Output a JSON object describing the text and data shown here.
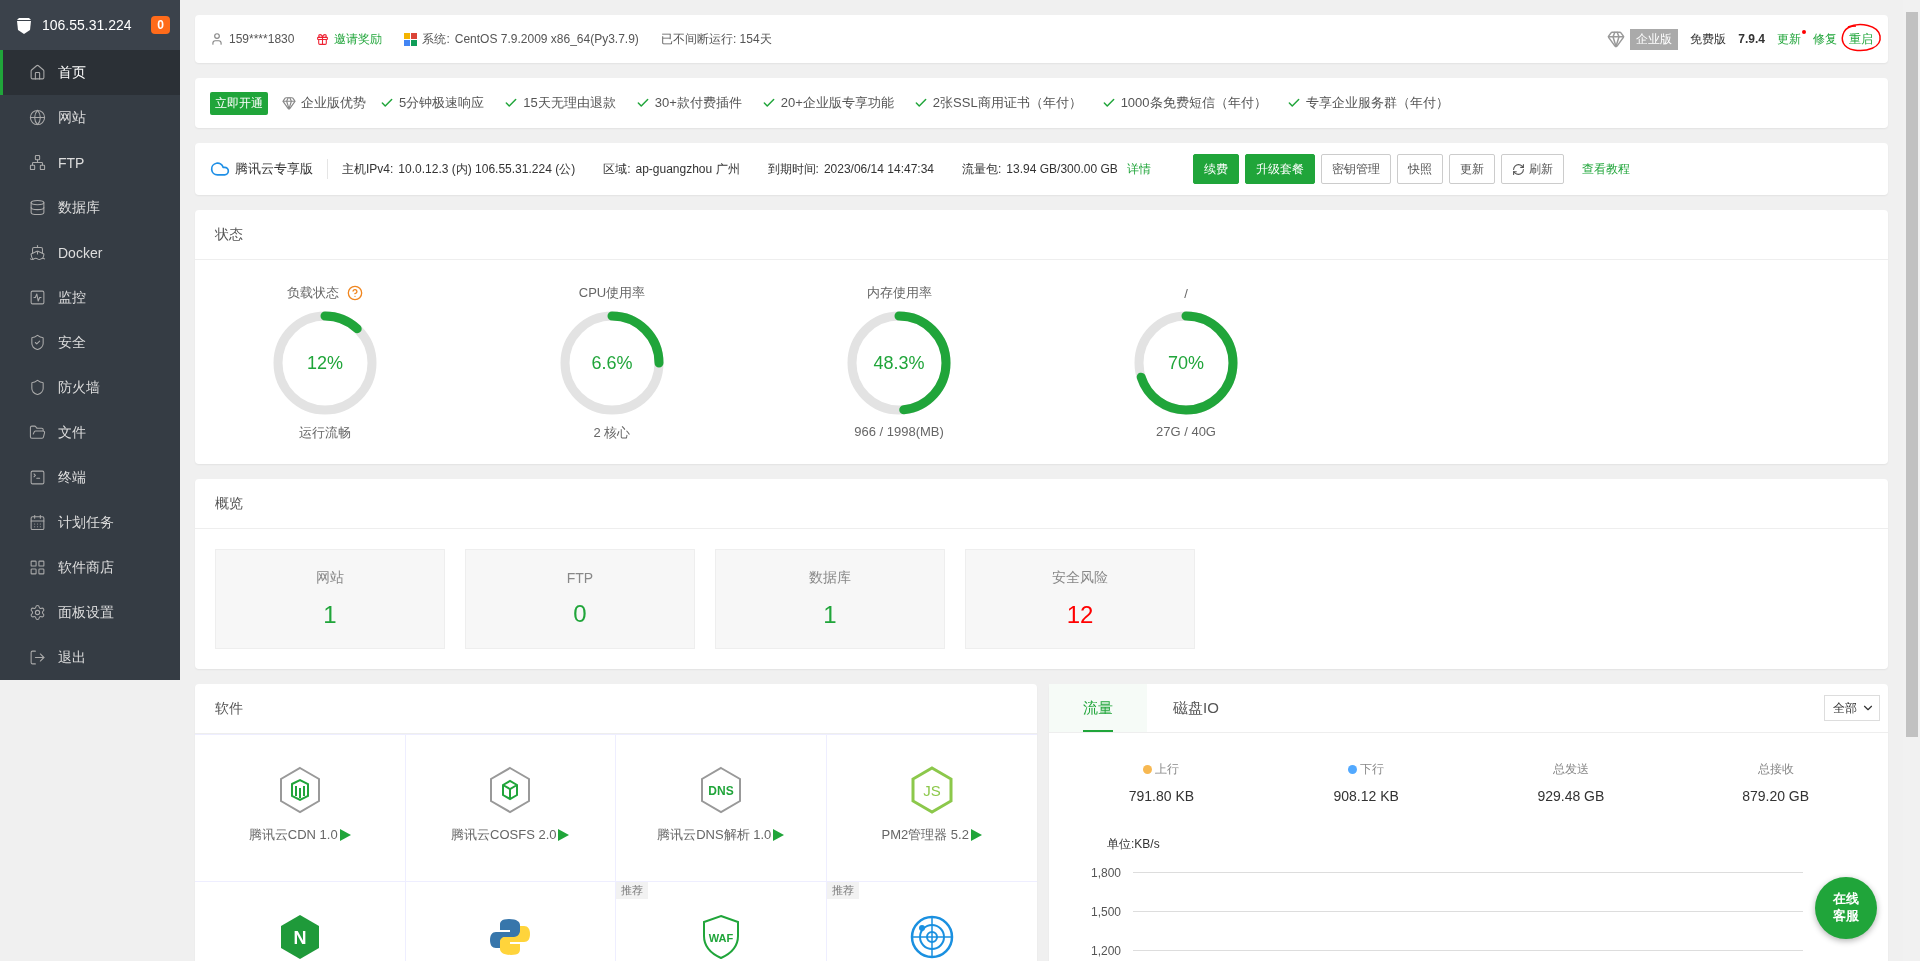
{
  "sidebar": {
    "host": "106.55.31.224",
    "badge": "0",
    "items": [
      {
        "label": "首页",
        "selected": true
      },
      {
        "label": "网站",
        "selected": false
      },
      {
        "label": "FTP",
        "selected": false
      },
      {
        "label": "数据库",
        "selected": false
      },
      {
        "label": "Docker",
        "selected": false
      },
      {
        "label": "监控",
        "selected": false
      },
      {
        "label": "安全",
        "selected": false
      },
      {
        "label": "防火墙",
        "selected": false
      },
      {
        "label": "文件",
        "selected": false
      },
      {
        "label": "终端",
        "selected": false
      },
      {
        "label": "计划任务",
        "selected": false
      },
      {
        "label": "软件商店",
        "selected": false
      },
      {
        "label": "面板设置",
        "selected": false
      },
      {
        "label": "退出",
        "selected": false
      }
    ]
  },
  "topbar": {
    "user": "159****1830",
    "invite": "邀请奖励",
    "system_label": "系统:",
    "system": "CentOS 7.9.2009 x86_64(Py3.7.9)",
    "uptime": "已不间断运行: 154天",
    "edition_badge": "企业版",
    "edition": "免费版",
    "version": "7.9.4",
    "links": [
      {
        "label": "更新",
        "dot": true,
        "annotated": false
      },
      {
        "label": "修复",
        "dot": false,
        "annotated": false
      },
      {
        "label": "重启",
        "dot": false,
        "annotated": true
      }
    ]
  },
  "promo": {
    "button": "立即开通",
    "title": "企业版优势",
    "features": [
      "5分钟极速响应",
      "15天无理由退款",
      "30+款付费插件",
      "20+企业版专享功能",
      "2张SSL商用证书（年付）",
      "1000条免费短信（年付）",
      "专享企业服务群（年付）"
    ]
  },
  "cloud": {
    "name": "腾讯云专享版",
    "fields": [
      {
        "label": "主机IPv4:",
        "value": "10.0.12.3 (内)  106.55.31.224 (公)"
      },
      {
        "label": "区域:",
        "value": "ap-guangzhou 广州"
      },
      {
        "label": "到期时间:",
        "value": "2023/06/14 14:47:34"
      },
      {
        "label": "流量包:",
        "value": "13.94 GB/300.00 GB"
      }
    ],
    "detail_link": "详情",
    "buttons": [
      {
        "label": "续费",
        "kind": "primary"
      },
      {
        "label": "升级套餐",
        "kind": "primary"
      },
      {
        "label": "密钥管理",
        "kind": "default"
      },
      {
        "label": "快照",
        "kind": "default"
      },
      {
        "label": "更新",
        "kind": "default"
      },
      {
        "label": "刷新",
        "kind": "refresh"
      }
    ],
    "tutorial": "查看教程"
  },
  "status": {
    "title": "状态",
    "gauges": [
      {
        "title": "负载状态",
        "help": true,
        "value": "12%",
        "level": 0.12,
        "caption": "运行流畅"
      },
      {
        "title": "CPU使用率",
        "help": false,
        "value": "6.6%",
        "level": 0.25,
        "caption": "2 核心"
      },
      {
        "title": "内存使用率",
        "help": false,
        "value": "48.3%",
        "level": 0.483,
        "caption": "966 / 1998(MB)"
      },
      {
        "title": "/",
        "help": false,
        "value": "70%",
        "level": 0.7,
        "caption": "27G / 40G"
      }
    ]
  },
  "overview": {
    "title": "概览",
    "tiles": [
      {
        "label": "网站",
        "value": "1",
        "alert": false
      },
      {
        "label": "FTP",
        "value": "0",
        "alert": false
      },
      {
        "label": "数据库",
        "value": "1",
        "alert": false
      },
      {
        "label": "安全风险",
        "value": "12",
        "alert": true
      }
    ]
  },
  "software": {
    "title": "软件",
    "items": [
      {
        "label": "腾讯云CDN 1.0",
        "recommended": false
      },
      {
        "label": "腾讯云COSFS 2.0",
        "recommended": false
      },
      {
        "label": "腾讯云DNS解析 1.0",
        "logo_text": "DNS",
        "recommended": false
      },
      {
        "label": "PM2管理器 5.2",
        "logo_text": "JS",
        "recommended": false
      },
      {
        "logo_text": "N",
        "recommended": false
      },
      {
        "recommended": false
      },
      {
        "logo_text": "WAF",
        "recommended": true,
        "badge": "推荐"
      },
      {
        "recommended": true,
        "badge": "推荐"
      }
    ]
  },
  "traffic": {
    "tabs": [
      {
        "label": "流量",
        "selected": true
      },
      {
        "label": "磁盘IO",
        "selected": false
      }
    ],
    "select": "全部",
    "stats": [
      {
        "label": "上行",
        "value": "791.80 KB",
        "color": "#f7b851"
      },
      {
        "label": "下行",
        "value": "908.12 KB",
        "color": "#52a9ff"
      },
      {
        "label": "总发送",
        "value": "929.48 GB"
      },
      {
        "label": "总接收",
        "value": "879.20 GB"
      }
    ],
    "unit": "单位:KB/s",
    "y_ticks": [
      "1,800",
      "1,500",
      "1,200"
    ]
  },
  "support_button": "在线客服"
}
